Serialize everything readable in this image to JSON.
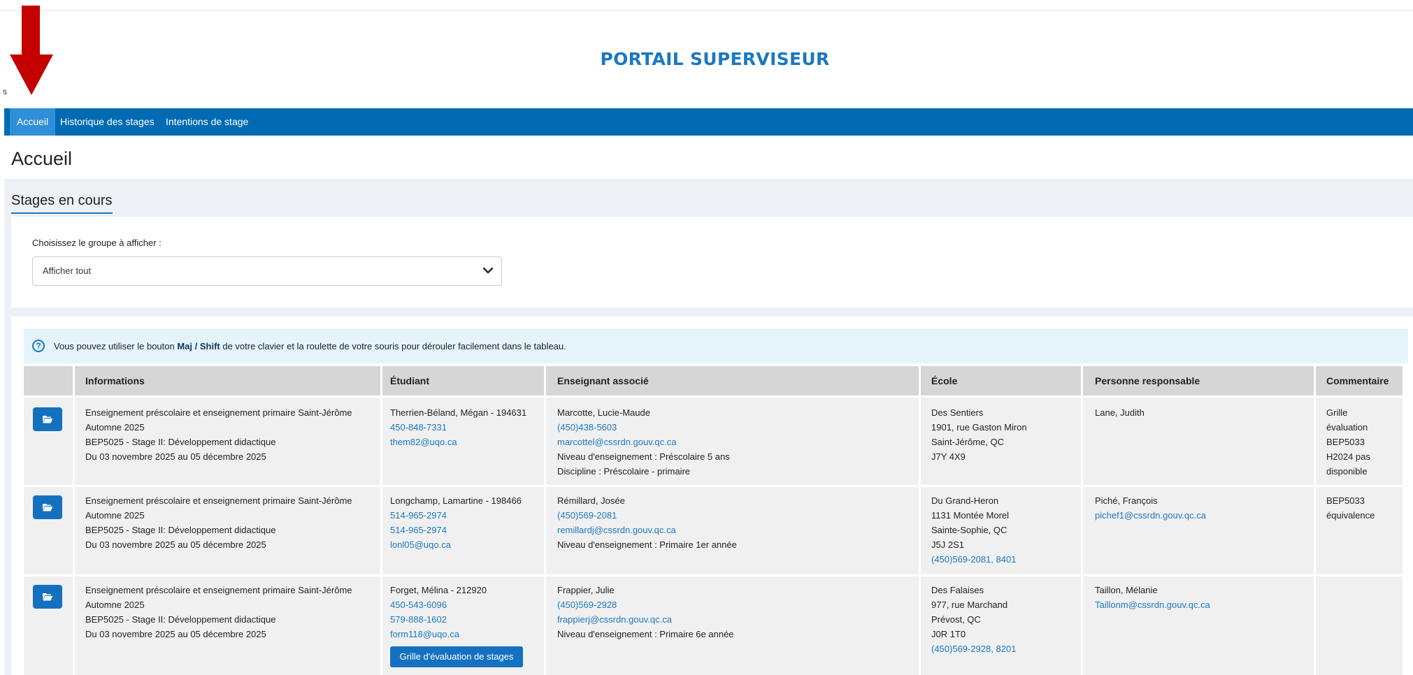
{
  "header": {
    "title": "PORTAIL SUPERVISEUR",
    "stray_mark": "s"
  },
  "nav": {
    "items": [
      {
        "label": "Accueil",
        "active": true
      },
      {
        "label": "Historique des stages",
        "active": false
      },
      {
        "label": "Intentions de stage",
        "active": false
      }
    ]
  },
  "page": {
    "heading": "Accueil",
    "section_title": "Stages en cours"
  },
  "filter": {
    "label": "Choisissez le groupe à afficher :",
    "value": "Afficher tout"
  },
  "info": {
    "text_before": "Vous pouvez utiliser le bouton ",
    "bold": "Maj / Shift",
    "text_after": " de votre clavier et la roulette de votre souris pour dérouler facilement dans le tableau."
  },
  "table": {
    "headers": {
      "informations": "Informations",
      "etudiant": "Étudiant",
      "enseignant": "Enseignant associé",
      "ecole": "École",
      "responsable": "Personne responsable",
      "commentaire": "Commentaire"
    },
    "rows": [
      {
        "info": {
          "programme": "Enseignement préscolaire et enseignement primaire Saint-Jérôme",
          "session": "Automne 2025",
          "cours": "BEP5025 - Stage II: Développement didactique",
          "dates": "Du 03 novembre 2025 au 05 décembre 2025"
        },
        "etudiant": {
          "name": "Therrien-Béland, Mégan - 194631",
          "phones": [
            "450-848-7331"
          ],
          "email": "them82@uqo.ca"
        },
        "enseignant": {
          "name": "Marcotte, Lucie-Maude",
          "phone": "(450)438-5603",
          "email": "marcottel@cssrdn.gouv.qc.ca",
          "details": [
            "Niveau d'enseignement : Préscolaire 5 ans",
            "Discipline : Préscolaire - primaire"
          ]
        },
        "ecole": {
          "lines": [
            "Des Sentiers",
            "1901, rue Gaston Miron",
            "Saint-Jérôme, QC",
            "J7Y 4X9"
          ],
          "phone": ""
        },
        "responsable": {
          "name": "Lane, Judith",
          "email": ""
        },
        "commentaire": [
          "Grille",
          "évaluation",
          "BEP5033",
          "H2024 pas",
          "disponible"
        ]
      },
      {
        "info": {
          "programme": "Enseignement préscolaire et enseignement primaire Saint-Jérôme",
          "session": "Automne 2025",
          "cours": "BEP5025 - Stage II: Développement didactique",
          "dates": "Du 03 novembre 2025 au 05 décembre 2025"
        },
        "etudiant": {
          "name": "Longchamp, Lamartine - 198466",
          "phones": [
            "514-965-2974",
            "514-965-2974"
          ],
          "email": "lonl05@uqo.ca"
        },
        "enseignant": {
          "name": "Rémillard, Josée",
          "phone": "(450)569-2081",
          "email": "remillardj@cssrdn.gouv.qc.ca",
          "details": [
            "Niveau d'enseignement : Primaire 1er année"
          ]
        },
        "ecole": {
          "lines": [
            "Du Grand-Heron",
            "1131 Montée Morel",
            "Sainte-Sophie, QC",
            "J5J 2S1"
          ],
          "phone": "(450)569-2081, 8401"
        },
        "responsable": {
          "name": "Piché, François",
          "email": "pichef1@cssrdn.gouv.qc.ca"
        },
        "commentaire": [
          "BEP5033",
          "équivalence"
        ]
      },
      {
        "info": {
          "programme": "Enseignement préscolaire et enseignement primaire Saint-Jérôme",
          "session": "Automne 2025",
          "cours": "BEP5025 - Stage II: Développement didactique",
          "dates": "Du 03 novembre 2025 au 05 décembre 2025"
        },
        "etudiant": {
          "name": "Forget, Mélina - 212920",
          "phones": [
            "450-543-6096",
            "579-888-1602"
          ],
          "email": "form118@uqo.ca",
          "button": "Grille d'évaluation de stages"
        },
        "enseignant": {
          "name": "Frappier, Julie",
          "phone": "(450)569-2928",
          "email": "frappierj@cssrdn.gouv.qc.ca",
          "details": [
            "Niveau d'enseignement : Primaire 6e année"
          ]
        },
        "ecole": {
          "lines": [
            "Des Falaises",
            "977, rue Marchand",
            "Prévost, QC",
            "J0R 1T0"
          ],
          "phone": "(450)569-2928, 8201"
        },
        "responsable": {
          "name": "Taillon, Mélanie",
          "email": "Taillonm@cssrdn.gouv.qc.ca"
        },
        "commentaire": []
      }
    ]
  },
  "colors": {
    "nav_bg": "#006bb3",
    "nav_active": "#2f8fd8",
    "accent": "#1b78c1",
    "button": "#1471c0",
    "annotation_arrow": "#c40000"
  }
}
